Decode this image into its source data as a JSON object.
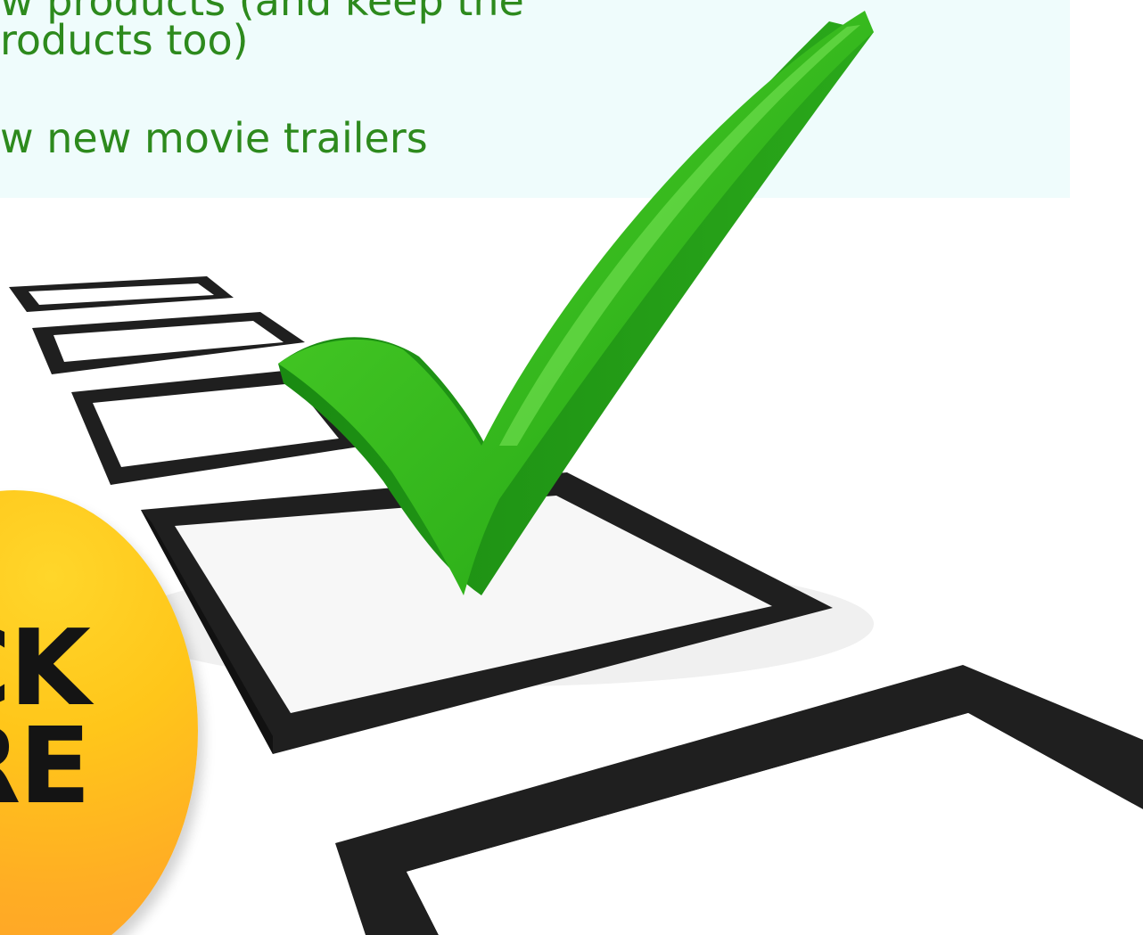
{
  "list": {
    "items": [
      "w products (and keep the",
      "roducts too)",
      "w new movie trailers"
    ]
  },
  "cta": {
    "line1": "CK",
    "line2": "RE"
  },
  "colors": {
    "list_text": "#2d8a1d",
    "panel_bg": "#effcfc",
    "checkmark": "#22b014",
    "badge": "#ffc61a",
    "box_stroke": "#1e1e1e"
  },
  "icons": {
    "checkmark": "checkmark-icon",
    "checkbox": "checkbox-icon"
  }
}
